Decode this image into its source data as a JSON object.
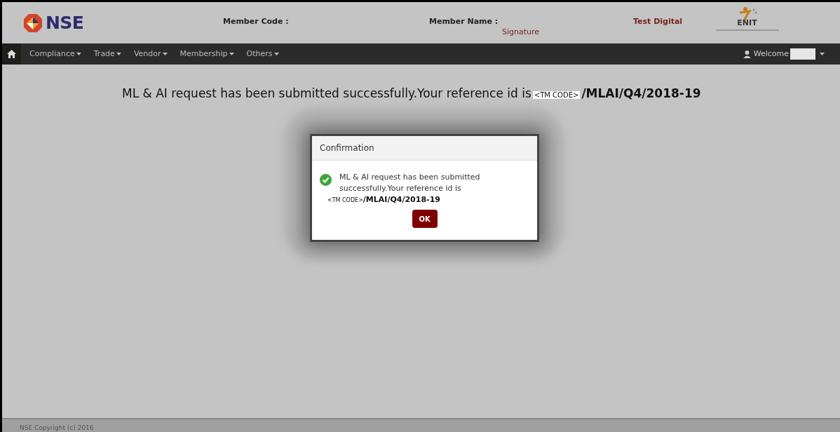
{
  "header": {
    "logo_text": "NSE",
    "member_code_label": "Member Code :",
    "member_name_label": "Member Name :",
    "signature": "Signature",
    "test_digital": "Test Digital",
    "partner_logo_text": "ENIT"
  },
  "nav": {
    "items": [
      {
        "label": "Compliance"
      },
      {
        "label": "Trade"
      },
      {
        "label": "Vendor"
      },
      {
        "label": "Membership"
      },
      {
        "label": "Others"
      }
    ],
    "welcome": "Welcome"
  },
  "banner": {
    "text": "ML & AI request has been submitted successfully.Your reference id is",
    "code": "<TM CODE>",
    "suffix": "/MLAI/Q4/2018-19"
  },
  "dialog": {
    "title": "Confirmation",
    "message": "ML & AI request has been submitted successfully.Your reference id is",
    "code": "<TM CODE>",
    "suffix": "/MLAI/Q4/2018-19",
    "ok": "OK"
  },
  "footer": {
    "text": "NSE Copyright (c) 2016"
  }
}
